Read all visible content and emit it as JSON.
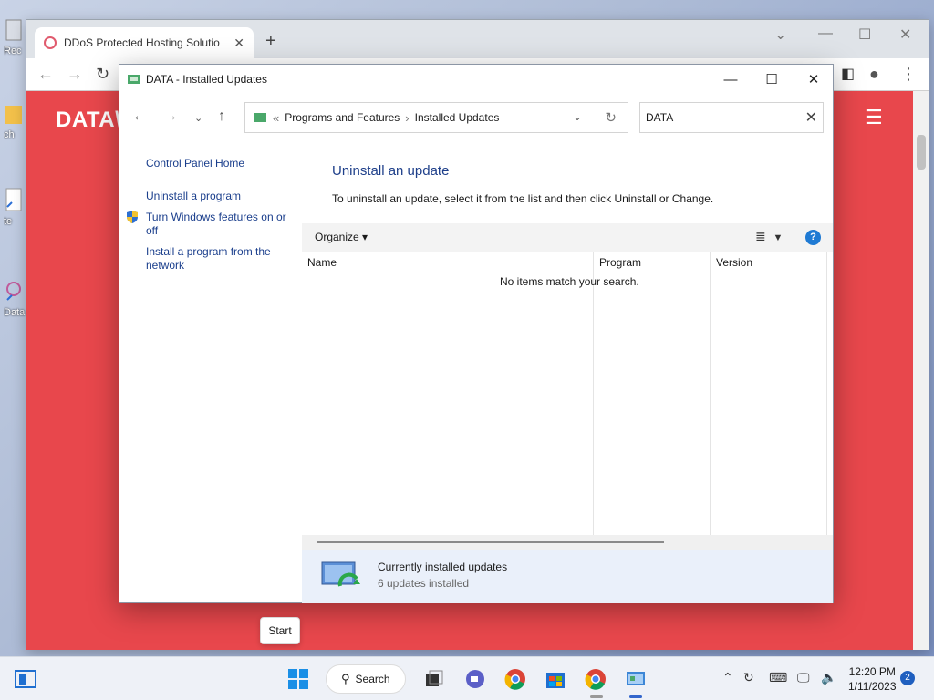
{
  "desktop": {
    "icons": [
      {
        "label": "Rec",
        "name": "recycle-bin"
      },
      {
        "label": "ch",
        "name": "folder"
      },
      {
        "label": "te",
        "name": "shortcut"
      },
      {
        "label": "Data",
        "name": "data-shortcut"
      }
    ]
  },
  "browser": {
    "tab_title": "DDoS Protected Hosting Solutio",
    "site_logo": "DATA\\"
  },
  "cp_window": {
    "title": "DATA - Installed Updates",
    "breadcrumb": [
      "Programs and Features",
      "Installed Updates"
    ],
    "breadcrumb_prefix": "«",
    "search_value": "DATA",
    "left_links": [
      "Control Panel Home",
      "Uninstall a program",
      "Turn Windows features on or off",
      "Install a program from the network"
    ],
    "heading": "Uninstall an update",
    "description": "To uninstall an update, select it from the list and then click Uninstall or Change.",
    "organize_label": "Organize",
    "columns": [
      "Name",
      "Program",
      "Version"
    ],
    "empty_message": "No items match your search.",
    "details_title": "Currently installed updates",
    "details_sub": "6 updates installed"
  },
  "tooltip": "Start",
  "taskbar": {
    "search_label": "Search",
    "time": "12:20 PM",
    "date": "1/11/2023",
    "notification_count": "2"
  },
  "colors": {
    "site_red": "#e8474c",
    "link_blue": "#1a3e8c",
    "heading_blue": "#1e3f8a"
  }
}
